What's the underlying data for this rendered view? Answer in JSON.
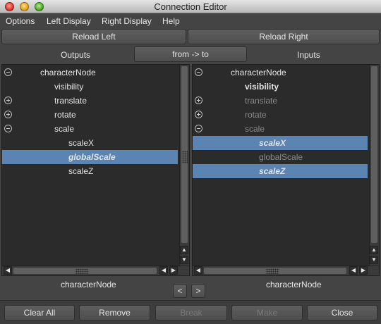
{
  "window": {
    "title": "Connection Editor"
  },
  "menu": [
    "Options",
    "Left Display",
    "Right Display",
    "Help"
  ],
  "toolbar": {
    "reload_left": "Reload Left",
    "reload_right": "Reload Right"
  },
  "headers": {
    "outputs": "Outputs",
    "direction": "from -> to",
    "inputs": "Inputs"
  },
  "left_panel": {
    "rows": [
      {
        "label": "characterNode",
        "icon": "minus"
      },
      {
        "label": "visibility"
      },
      {
        "label": "translate",
        "icon": "plus"
      },
      {
        "label": "rotate",
        "icon": "plus"
      },
      {
        "label": "scale",
        "icon": "minus"
      },
      {
        "label": "scaleX"
      },
      {
        "label": "globalScale",
        "selected": true
      },
      {
        "label": "scaleZ"
      }
    ],
    "node_name": "characterNode"
  },
  "right_panel": {
    "rows": [
      {
        "label": "characterNode",
        "icon": "minus"
      },
      {
        "label": "visibility"
      },
      {
        "label": "translate",
        "icon": "plus"
      },
      {
        "label": "rotate",
        "icon": "plus"
      },
      {
        "label": "scale",
        "icon": "minus"
      },
      {
        "label": "scaleX",
        "selected": true
      },
      {
        "label": "globalScale"
      },
      {
        "label": "scaleZ",
        "selected": true
      }
    ],
    "node_name": "characterNode"
  },
  "nav": {
    "prev": "<",
    "next": ">"
  },
  "actions": {
    "clear_all": "Clear All",
    "remove": "Remove",
    "break": "Break",
    "make": "Make",
    "close": "Close"
  },
  "colors": {
    "selection": "#5b84b2",
    "panel_bg": "#2b2b2b",
    "window_bg": "#444444"
  }
}
